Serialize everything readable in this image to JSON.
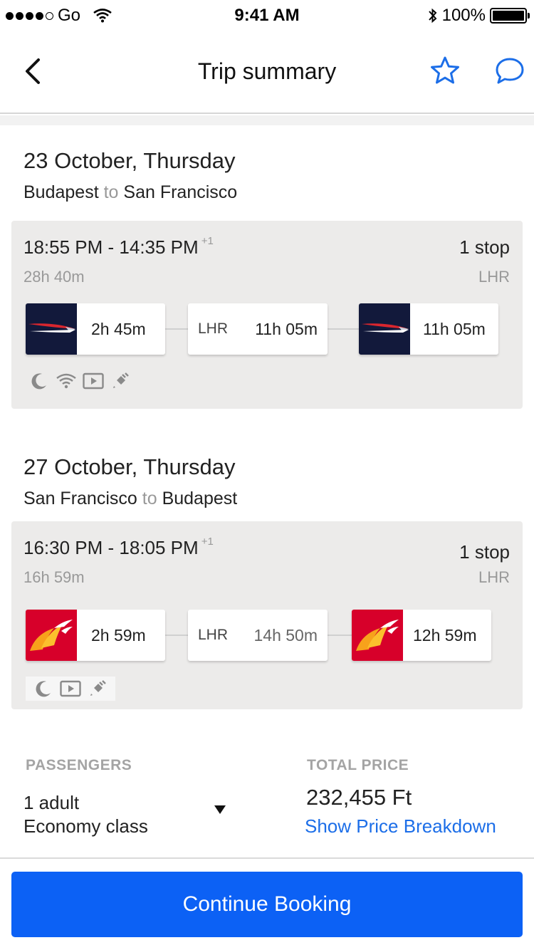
{
  "status_bar": {
    "carrier": "Go",
    "time": "9:41 AM",
    "battery": "100%"
  },
  "nav": {
    "title": "Trip summary"
  },
  "trips": [
    {
      "date": "23 October, Thursday",
      "origin": "Budapest",
      "connector": "to",
      "destination": "San Francisco",
      "times": "18:55 PM - 14:35 PM",
      "day_offset": "+1",
      "duration": "28h 40m",
      "stops": "1 stop",
      "stop_code": "LHR",
      "segments": [
        {
          "airline_logo": "british-airways",
          "duration": "2h 45m"
        },
        {
          "code": "LHR",
          "duration": "11h 05m"
        },
        {
          "airline_logo": "british-airways",
          "duration": "11h 05m"
        }
      ],
      "amenities": [
        "moon-icon",
        "wifi-icon",
        "video-icon",
        "plug-icon"
      ]
    },
    {
      "date": "27 October, Thursday",
      "origin": "San Francisco",
      "connector": "to",
      "destination": "Budapest",
      "times": "16:30 PM - 18:05 PM",
      "day_offset": "+1",
      "duration": "16h 59m",
      "stops": "1 stop",
      "stop_code": "LHR",
      "segments": [
        {
          "airline_logo": "iberia",
          "duration": "2h 59m"
        },
        {
          "code": "LHR",
          "duration": "14h 50m"
        },
        {
          "airline_logo": "iberia",
          "duration": "12h 59m"
        }
      ],
      "amenities": [
        "moon-icon",
        "video-icon",
        "plug-icon"
      ]
    }
  ],
  "passengers": {
    "label": "PASSENGERS",
    "count": "1 adult",
    "class": "Economy class"
  },
  "price": {
    "label": "TOTAL PRICE",
    "amount": "232,455 Ft",
    "breakdown_link": "Show Price Breakdown"
  },
  "cta": {
    "label": "Continue Booking"
  },
  "colors": {
    "accent": "#0c61f5",
    "link": "#1c6ee8",
    "ba_navy": "#12193b",
    "iberia_red": "#d7002a"
  }
}
